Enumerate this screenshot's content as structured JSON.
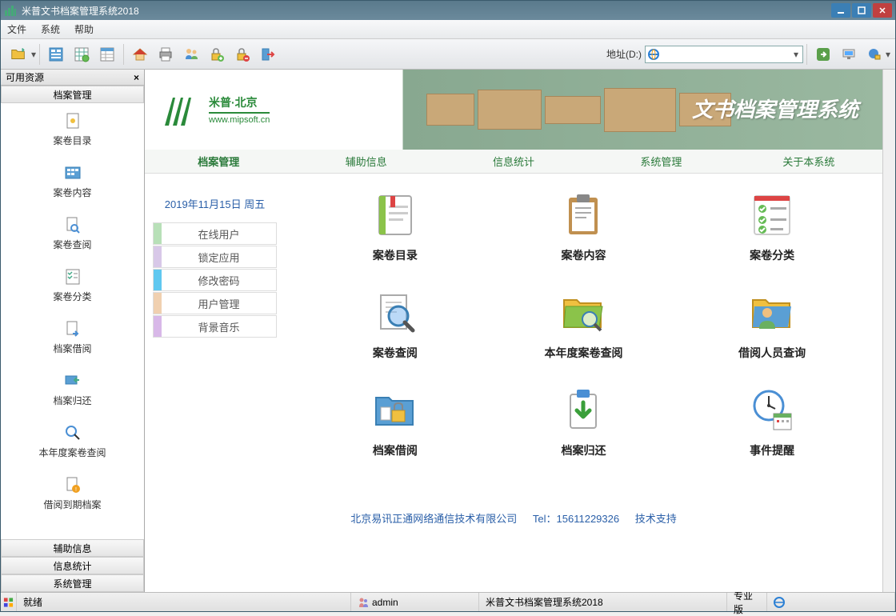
{
  "app": {
    "title": "米普文书档案管理系统2018"
  },
  "menu": {
    "file": "文件",
    "system": "系统",
    "help": "帮助"
  },
  "toolbar": {
    "addr_label": "地址(D:)",
    "addr_value": ""
  },
  "sidebar": {
    "title": "可用资源",
    "headers": {
      "main": "档案管理",
      "aux": "辅助信息",
      "stats": "信息统计",
      "sys": "系统管理"
    },
    "items": [
      {
        "label": "案卷目录"
      },
      {
        "label": "案卷内容"
      },
      {
        "label": "案卷查阅"
      },
      {
        "label": "案卷分类"
      },
      {
        "label": "档案借阅"
      },
      {
        "label": "档案归还"
      },
      {
        "label": "本年度案卷查阅"
      },
      {
        "label": "借阅到期档案"
      }
    ]
  },
  "banner": {
    "brand": "米普·北京",
    "url": "www.mipsoft.cn",
    "title": "文书档案管理系统"
  },
  "navtabs": [
    "档案管理",
    "辅助信息",
    "信息统计",
    "系统管理",
    "关于本系统"
  ],
  "leftpanel": {
    "date": "2019年11月15日 周五",
    "buttons": [
      {
        "label": "在线用户",
        "color": "#b8e0b8"
      },
      {
        "label": "锁定应用",
        "color": "#d8c8e8"
      },
      {
        "label": "修改密码",
        "color": "#60c8f0"
      },
      {
        "label": "用户管理",
        "color": "#f0d0b0"
      },
      {
        "label": "背景音乐",
        "color": "#d8b8e8"
      }
    ]
  },
  "grid": {
    "rows": [
      [
        {
          "label": "案卷目录"
        },
        {
          "label": "案卷内容"
        },
        {
          "label": "案卷分类"
        }
      ],
      [
        {
          "label": "案卷查阅"
        },
        {
          "label": "本年度案卷查阅"
        },
        {
          "label": "借阅人员查询"
        }
      ],
      [
        {
          "label": "档案借阅"
        },
        {
          "label": "档案归还"
        },
        {
          "label": "事件提醒"
        }
      ]
    ]
  },
  "footer": {
    "company": "北京易讯正通网络通信技术有限公司",
    "tel": "Tel：15611229326",
    "support": "技术支持"
  },
  "statusbar": {
    "ready": "就绪",
    "user": "admin",
    "app": "米普文书档案管理系统2018",
    "edition": "专业版"
  }
}
